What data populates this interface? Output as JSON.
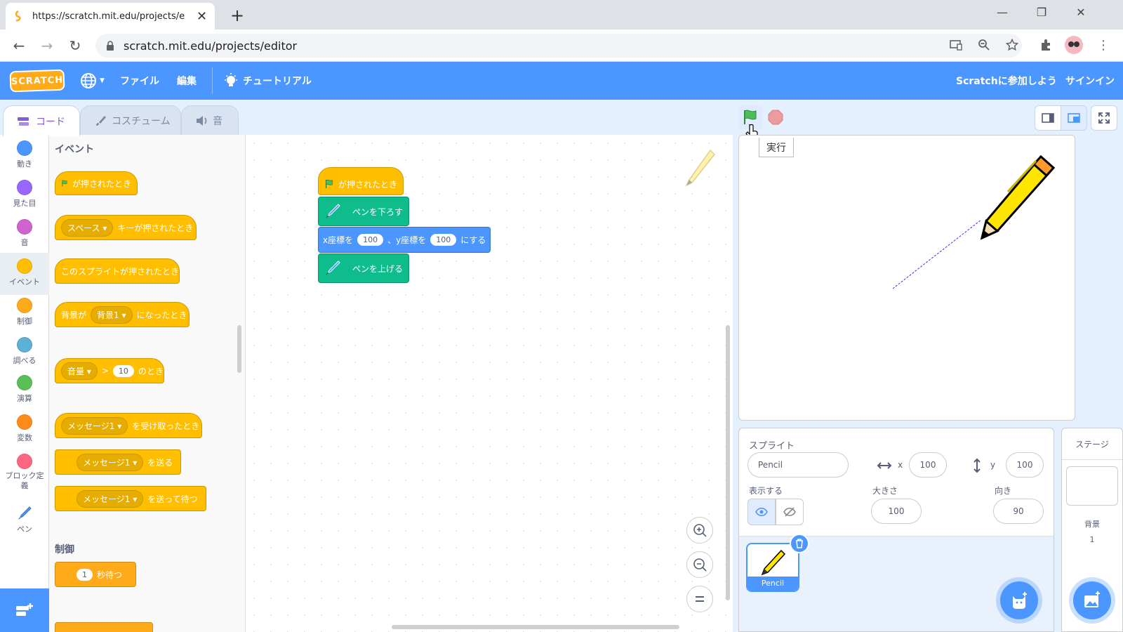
{
  "browser": {
    "tab_title": "https://scratch.mit.edu/projects/e",
    "url": "scratch.mit.edu/projects/editor",
    "new_tab": "+",
    "close_tab": "✕"
  },
  "menu": {
    "logo": "SCRATCH",
    "file": "ファイル",
    "edit": "編集",
    "tutorial": "チュートリアル",
    "join": "Scratchに参加しよう",
    "signin": "サインイン"
  },
  "tabs": {
    "code": "コード",
    "costume": "コスチューム",
    "sound": "音"
  },
  "categories": [
    {
      "label": "動き",
      "color": "#4c97ff"
    },
    {
      "label": "見た目",
      "color": "#9966ff"
    },
    {
      "label": "音",
      "color": "#cf63cf"
    },
    {
      "label": "イベント",
      "color": "#ffbf00"
    },
    {
      "label": "制御",
      "color": "#ffab19"
    },
    {
      "label": "調べる",
      "color": "#5cb1d6"
    },
    {
      "label": "演算",
      "color": "#59c059"
    },
    {
      "label": "変数",
      "color": "#ff8c1a"
    },
    {
      "label": "ブロック定義",
      "color": "#ff6680"
    },
    {
      "label": "ペン",
      "color": "#0fbd8c"
    }
  ],
  "palette": {
    "events_heading": "イベント",
    "flag_clicked": "が押されたとき",
    "key_dropdown": "スペース",
    "key_pressed": "キーが押されたとき",
    "sprite_clicked": "このスプライトが押されたとき",
    "backdrop_prefix": "背景が",
    "backdrop_dropdown": "背景1",
    "backdrop_suffix": "になったとき",
    "loudness_dropdown": "音量",
    "gt": ">",
    "loudness_value": "10",
    "loudness_suffix": "のとき",
    "message_dropdown": "メッセージ1",
    "receive_suffix": "を受け取ったとき",
    "broadcast_suffix": "を送る",
    "broadcast_wait_suffix": "を送って待つ",
    "control_heading": "制御",
    "wait_value": "1",
    "wait_suffix": "秒待つ"
  },
  "script": {
    "hat": "が押されたとき",
    "pen_down": "ペンを下ろす",
    "goto_x_label": "x座標を",
    "goto_x": "100",
    "goto_y_label": "、y座標を",
    "goto_y": "100",
    "goto_suffix": "にする",
    "pen_up": "ペンを上げる"
  },
  "stage": {
    "tooltip": "実行"
  },
  "sprite_info": {
    "sprite_label": "スプライト",
    "sprite_name": "Pencil",
    "x_label": "x",
    "x_value": "100",
    "y_label": "y",
    "y_value": "100",
    "show_label": "表示する",
    "size_label": "大きさ",
    "size_value": "100",
    "direction_label": "向き",
    "direction_value": "90",
    "thumb_name": "Pencil"
  },
  "stage_panel": {
    "title": "ステージ",
    "backdrops_label": "背景",
    "backdrops_count": "1"
  },
  "colors": {
    "menu_blue": "#4c97ff",
    "events": "#ffbf00",
    "pen": "#0fbd8c",
    "motion": "#4c97ff"
  }
}
